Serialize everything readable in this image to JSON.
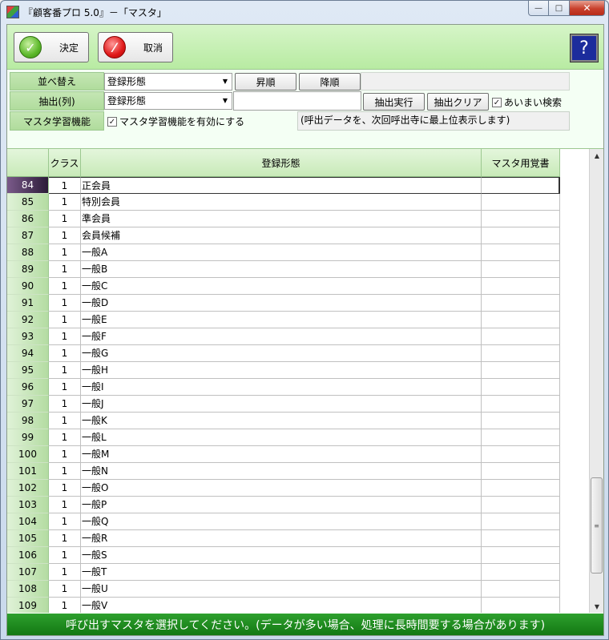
{
  "window": {
    "title": "『顧客番プロ 5.0』－「マスタ」"
  },
  "toolbar": {
    "ok_label": "決定",
    "cancel_label": "取消",
    "help_label": "?"
  },
  "controls": {
    "sort_label": "並べ替え",
    "sort_value": "登録形態",
    "asc_label": "昇順",
    "desc_label": "降順",
    "filter_label": "抽出(列)",
    "filter_value": "登録形態",
    "filter_text": "",
    "run_filter_label": "抽出実行",
    "clear_filter_label": "抽出クリア",
    "fuzzy_label": "あいまい検索",
    "fuzzy_checked": true,
    "learning_label": "マスタ学習機能",
    "learning_check_label": "マスタ学習機能を有効にする",
    "learning_checked": true,
    "learning_note": "(呼出データを、次回呼出寺に最上位表示します)"
  },
  "grid": {
    "headers": [
      "",
      "クラス",
      "登録形態",
      "マスタ用覚書"
    ],
    "selected_row": 0,
    "rows": [
      {
        "no": "84",
        "cls": "1",
        "name": "正会員",
        "memo": ""
      },
      {
        "no": "85",
        "cls": "1",
        "name": "特別会員",
        "memo": ""
      },
      {
        "no": "86",
        "cls": "1",
        "name": "準会員",
        "memo": ""
      },
      {
        "no": "87",
        "cls": "1",
        "name": "会員候補",
        "memo": ""
      },
      {
        "no": "88",
        "cls": "1",
        "name": "一般A",
        "memo": ""
      },
      {
        "no": "89",
        "cls": "1",
        "name": "一般B",
        "memo": ""
      },
      {
        "no": "90",
        "cls": "1",
        "name": "一般C",
        "memo": ""
      },
      {
        "no": "91",
        "cls": "1",
        "name": "一般D",
        "memo": ""
      },
      {
        "no": "92",
        "cls": "1",
        "name": "一般E",
        "memo": ""
      },
      {
        "no": "93",
        "cls": "1",
        "name": "一般F",
        "memo": ""
      },
      {
        "no": "94",
        "cls": "1",
        "name": "一般G",
        "memo": ""
      },
      {
        "no": "95",
        "cls": "1",
        "name": "一般H",
        "memo": ""
      },
      {
        "no": "96",
        "cls": "1",
        "name": "一般I",
        "memo": ""
      },
      {
        "no": "97",
        "cls": "1",
        "name": "一般J",
        "memo": ""
      },
      {
        "no": "98",
        "cls": "1",
        "name": "一般K",
        "memo": ""
      },
      {
        "no": "99",
        "cls": "1",
        "name": "一般L",
        "memo": ""
      },
      {
        "no": "100",
        "cls": "1",
        "name": "一般M",
        "memo": ""
      },
      {
        "no": "101",
        "cls": "1",
        "name": "一般N",
        "memo": ""
      },
      {
        "no": "102",
        "cls": "1",
        "name": "一般O",
        "memo": ""
      },
      {
        "no": "103",
        "cls": "1",
        "name": "一般P",
        "memo": ""
      },
      {
        "no": "104",
        "cls": "1",
        "name": "一般Q",
        "memo": ""
      },
      {
        "no": "105",
        "cls": "1",
        "name": "一般R",
        "memo": ""
      },
      {
        "no": "106",
        "cls": "1",
        "name": "一般S",
        "memo": ""
      },
      {
        "no": "107",
        "cls": "1",
        "name": "一般T",
        "memo": ""
      },
      {
        "no": "108",
        "cls": "1",
        "name": "一般U",
        "memo": ""
      },
      {
        "no": "109",
        "cls": "1",
        "name": "一般V",
        "memo": ""
      }
    ]
  },
  "status": {
    "message": "呼び出すマスタを選択してください。(データが多い場合、処理に長時間要する場合があります)"
  }
}
